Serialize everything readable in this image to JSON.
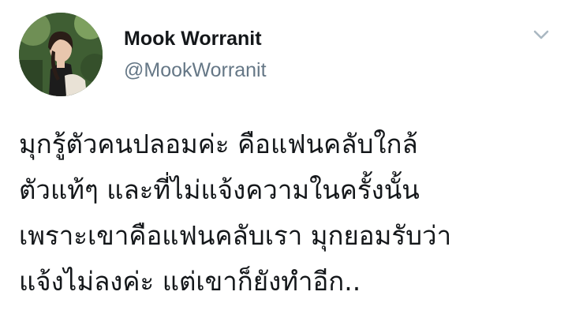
{
  "author": {
    "display_name": "Mook Worranit",
    "handle": "@MookWorranit",
    "avatar_icon": "profile-photo"
  },
  "menu": {
    "icon": "chevron-down-icon"
  },
  "tweet": {
    "lines": [
      "มุกรู้ตัวคนปลอมค่ะ คือแฟนคลับใกล้",
      "ตัวแท้ๆ และที่ไม่แจ้งความในครั้งนั้น",
      "เพราะเขาคือแฟนคลับเรา มุกยอมรับว่า",
      "แจ้งไม่ลงค่ะ แต่เขาก็ยังทำอีก.."
    ]
  },
  "colors": {
    "text": "#14171a",
    "secondary": "#657786",
    "chevron": "#aab8c2",
    "background": "#ffffff"
  }
}
